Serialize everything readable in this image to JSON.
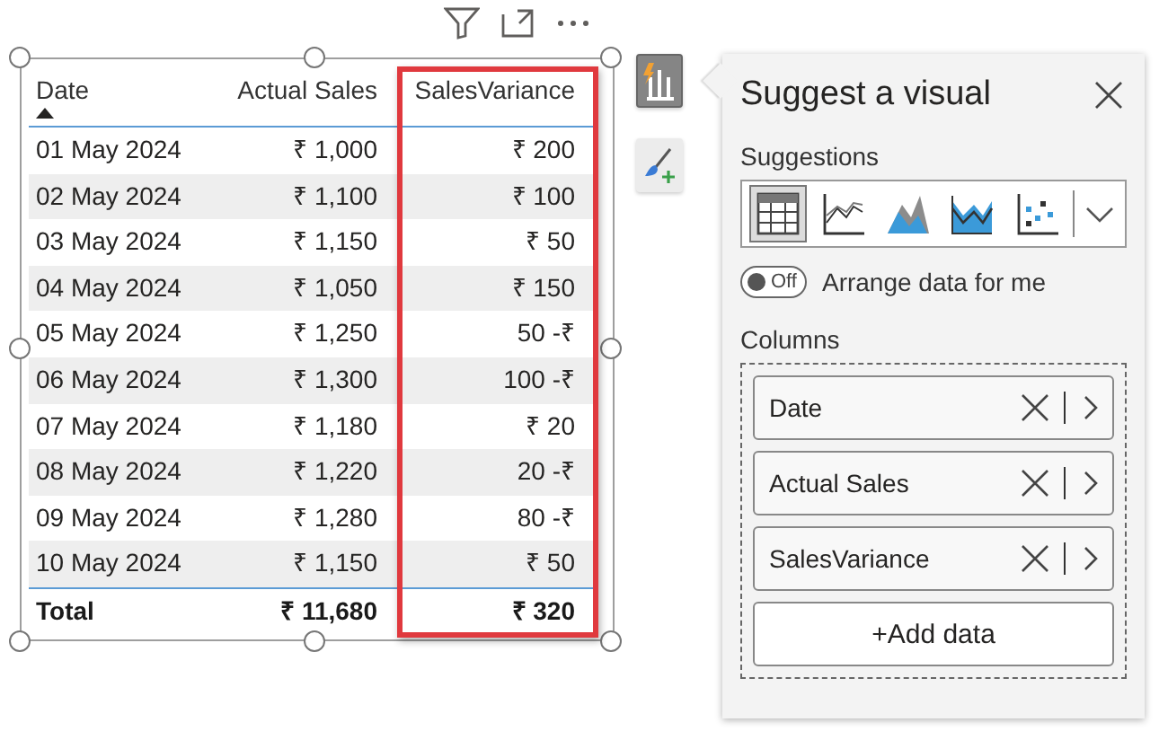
{
  "table": {
    "columns": [
      {
        "label": "Date",
        "sorted": true,
        "highlighted": false
      },
      {
        "label": "Actual Sales",
        "sorted": false,
        "highlighted": false
      },
      {
        "label": "SalesVariance",
        "sorted": false,
        "highlighted": true
      }
    ],
    "rows": [
      [
        "01 May 2024",
        "₹ 1,000",
        "₹ 200"
      ],
      [
        "02 May 2024",
        "₹ 1,100",
        "₹ 100"
      ],
      [
        "03 May 2024",
        "₹ 1,150",
        "₹ 50"
      ],
      [
        "04 May 2024",
        "₹ 1,050",
        "₹ 150"
      ],
      [
        "05 May 2024",
        "₹ 1,250",
        "50 -₹"
      ],
      [
        "06 May 2024",
        "₹ 1,300",
        "100 -₹"
      ],
      [
        "07 May 2024",
        "₹ 1,180",
        "₹ 20"
      ],
      [
        "08 May 2024",
        "₹ 1,220",
        "20 -₹"
      ],
      [
        "09 May 2024",
        "₹ 1,280",
        "80 -₹"
      ],
      [
        "10 May 2024",
        "₹ 1,150",
        "₹ 50"
      ]
    ],
    "total": [
      "Total",
      "₹ 11,680",
      "₹ 320"
    ]
  },
  "side_buttons": [
    {
      "kind": "suggest",
      "selected": true
    },
    {
      "kind": "format",
      "selected": false
    }
  ],
  "panel": {
    "title": "Suggest a visual",
    "suggestions_label": "Suggestions",
    "suggestions": [
      {
        "kind": "table",
        "selected": true
      },
      {
        "kind": "line",
        "selected": false
      },
      {
        "kind": "area",
        "selected": false
      },
      {
        "kind": "ribbon",
        "selected": false
      },
      {
        "kind": "scatter",
        "selected": false
      }
    ],
    "toggle": {
      "on": false,
      "state_text": "Off",
      "label": "Arrange data for me"
    },
    "columns_label": "Columns",
    "fields": [
      "Date",
      "Actual Sales",
      "SalesVariance"
    ],
    "add_button": "+Add data"
  }
}
